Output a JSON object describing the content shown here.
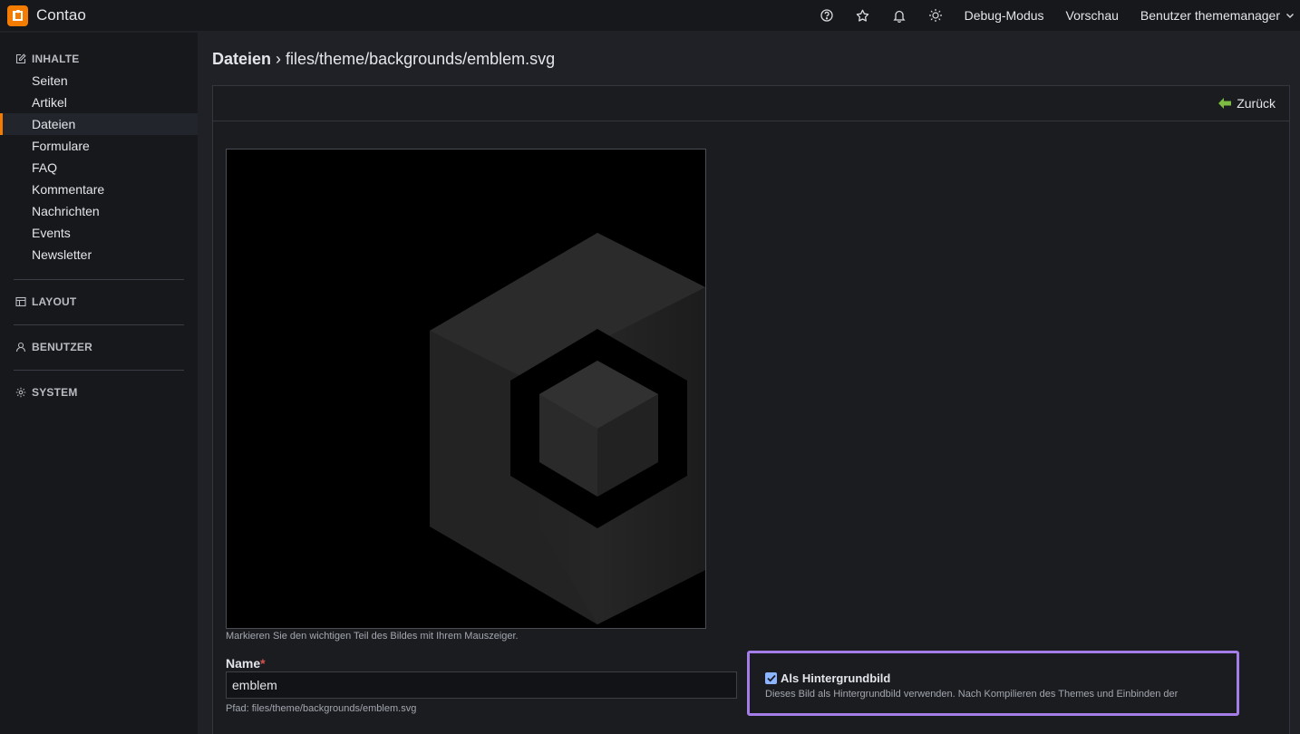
{
  "app": {
    "name": "Contao"
  },
  "header": {
    "icons": [
      "help-icon",
      "star-icon",
      "bell-icon",
      "sun-icon"
    ],
    "debug_label": "Debug-Modus",
    "preview_label": "Vorschau",
    "user_label": "Benutzer thememanager"
  },
  "sidebar": {
    "groups": [
      {
        "label": "INHALTE",
        "icon": "edit-icon"
      },
      {
        "label": "LAYOUT",
        "icon": "layout-icon"
      },
      {
        "label": "BENUTZER",
        "icon": "user-icon"
      },
      {
        "label": "SYSTEM",
        "icon": "gear-icon"
      }
    ],
    "items": [
      "Seiten",
      "Artikel",
      "Dateien",
      "Formulare",
      "FAQ",
      "Kommentare",
      "Nachrichten",
      "Events",
      "Newsletter"
    ],
    "active_item": "Dateien"
  },
  "main": {
    "title_bold": "Dateien",
    "title_path": "› files/theme/backgrounds/emblem.svg",
    "back_label": "Zurück",
    "preview_hint": "Markieren Sie den wichtigen Teil des Bildes mit Ihrem Mauszeiger.",
    "name_label": "Name",
    "required_mark": "*",
    "name_value": "emblem",
    "path_text": "Pfad: files/theme/backgrounds/emblem.svg",
    "background_checkbox": {
      "label": "Als Hintergrundbild",
      "checked": true,
      "description": "Dieses Bild als Hintergrundbild verwenden. Nach Kompilieren des Themes und Einbinden der"
    }
  },
  "colors": {
    "accent": "#f47c00",
    "highlight": "#a47de8",
    "checkbox": "#8cb4ff"
  }
}
